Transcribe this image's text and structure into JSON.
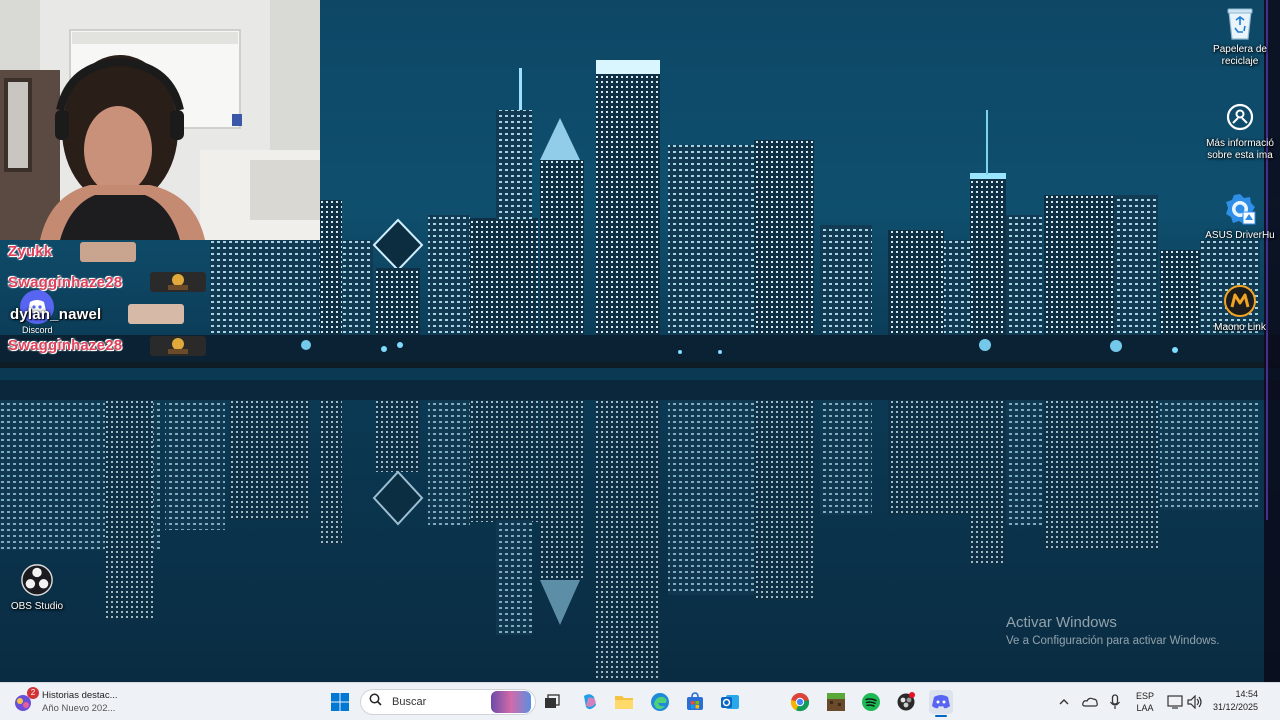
{
  "desktop": {
    "icons": [
      {
        "id": "recycle-bin",
        "label": "Papelera de\nreciclaje",
        "icon": "recycle-bin-icon"
      },
      {
        "id": "spotlight",
        "label": "Más informació\nsobre esta ima",
        "icon": "camera-info-icon"
      },
      {
        "id": "asus-driverhub",
        "label": "ASUS DriverHu",
        "icon": "asus-driverhub-icon"
      },
      {
        "id": "maono-link",
        "label": "Maono Link",
        "icon": "maono-link-icon"
      },
      {
        "id": "obs-studio",
        "label": "OBS Studio",
        "icon": "obs-icon"
      }
    ]
  },
  "voice_overlay": {
    "members": [
      {
        "name": "Zyukk",
        "color": "#e0405a"
      },
      {
        "name": "Swagginhaze28",
        "color": "#e0405a"
      },
      {
        "name": "dylan_nawel",
        "color": "#ffffff"
      },
      {
        "name": "Swagginhaze28",
        "color": "#e0405a"
      }
    ],
    "app_label": "Discord"
  },
  "watermark": {
    "title": "Activar Windows",
    "subtitle": "Ve a Configuración para activar Windows."
  },
  "taskbar": {
    "news": {
      "badge": "2",
      "title": "Historias destac...",
      "subtitle": "Año Nuevo 202..."
    },
    "search_placeholder": "Buscar",
    "pinned": [
      "windows-start-icon",
      "search-icon",
      "task-view-icon",
      "terminal-icon",
      "copilot-icon",
      "file-explorer-icon",
      "edge-icon",
      "store-icon",
      "outlook-icon",
      "chrome-icon",
      "minecraft-icon",
      "spotify-icon",
      "davinci-icon",
      "discord-icon"
    ],
    "tray": {
      "language_top": "ESP",
      "language_bottom": "LAA",
      "time": "14:54",
      "date": "31/12/2025"
    }
  },
  "colors": {
    "sky": "#0c3a55",
    "water": "#0a2e45",
    "city_glow": "#46c8ff",
    "taskbar": "#eef1f6",
    "accent": "#0067c0"
  }
}
